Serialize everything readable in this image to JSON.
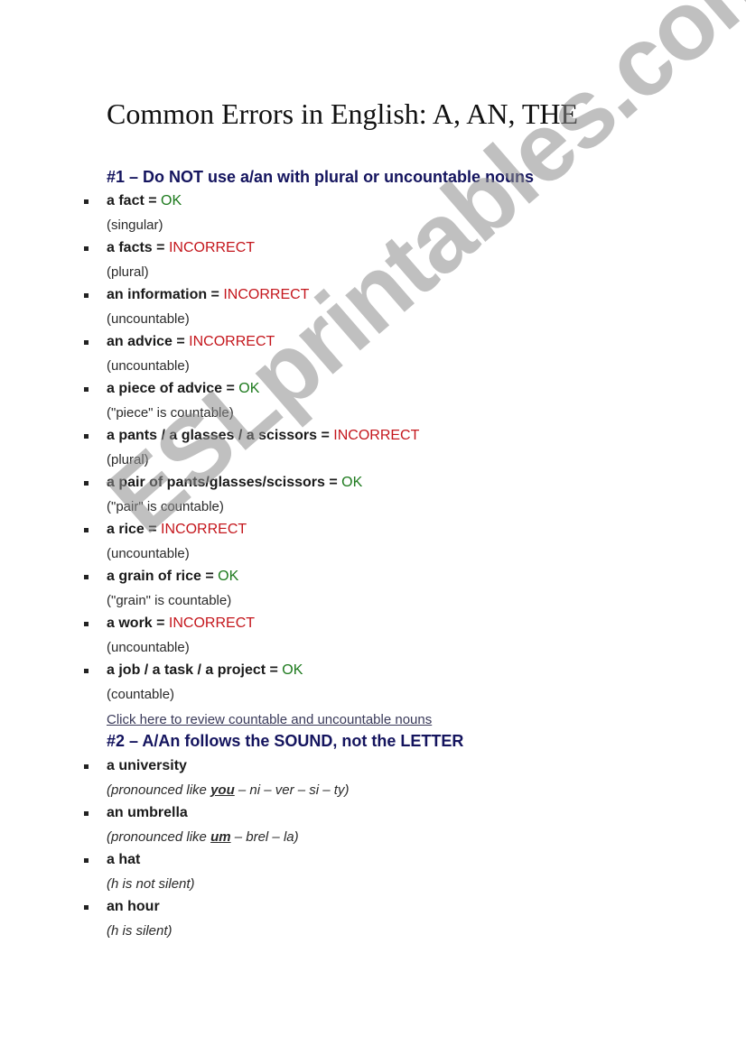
{
  "document": {
    "title": "Common Errors in English: A, AN, THE",
    "watermark": "ESLprintables.com",
    "colors": {
      "ok": "#1d7a1d",
      "incorrect": "#c4161c",
      "heading": "#14145e"
    }
  },
  "section1": {
    "heading": "#1 – Do NOT use a/an with plural or uncountable nouns",
    "items": [
      {
        "term": "a fact = ",
        "verdict": "OK",
        "status": "ok",
        "note": "(singular)"
      },
      {
        "term": "a facts = ",
        "verdict": "INCORRECT",
        "status": "incorrect",
        "note": "(plural)"
      },
      {
        "term": "an information = ",
        "verdict": "INCORRECT",
        "status": "incorrect",
        "note": "(uncountable)"
      },
      {
        "term": "an advice = ",
        "verdict": "INCORRECT",
        "status": "incorrect",
        "note": "(uncountable)"
      },
      {
        "term": "a piece of advice = ",
        "verdict": "OK",
        "status": "ok",
        "note": "(\"piece\" is countable)"
      },
      {
        "term": "a pants / a glasses / a scissors = ",
        "verdict": "INCORRECT",
        "status": "incorrect",
        "note": "(plural)"
      },
      {
        "term": "a pair of pants/glasses/scissors = ",
        "verdict": "OK",
        "status": "ok",
        "note": "(\"pair\" is countable)"
      },
      {
        "term": "a rice = ",
        "verdict": "INCORRECT",
        "status": "incorrect",
        "note": "(uncountable)"
      },
      {
        "term": "a grain of rice = ",
        "verdict": "OK",
        "status": "ok",
        "note": "(\"grain\" is countable)"
      },
      {
        "term": "a work = ",
        "verdict": "INCORRECT",
        "status": "incorrect",
        "note": "(uncountable)"
      },
      {
        "term": "a job / a task / a project = ",
        "verdict": "OK",
        "status": "ok",
        "note": "(countable)"
      }
    ],
    "link": "Click here to review countable and uncountable nouns"
  },
  "section2": {
    "heading": "#2 – A/An follows the SOUND, not the LETTER",
    "items": [
      {
        "term": "a university",
        "note_pre": "(pronounced like ",
        "note_em": "you",
        "note_post": " – ni – ver – si – ty)"
      },
      {
        "term": "an umbrella",
        "note_pre": "(pronounced like ",
        "note_em": "um",
        "note_post": " – brel – la)"
      },
      {
        "term": "a hat",
        "note_pre": "(h is not silent)",
        "note_em": "",
        "note_post": ""
      },
      {
        "term": "an hour",
        "note_pre": "(h is silent)",
        "note_em": "",
        "note_post": ""
      }
    ]
  }
}
